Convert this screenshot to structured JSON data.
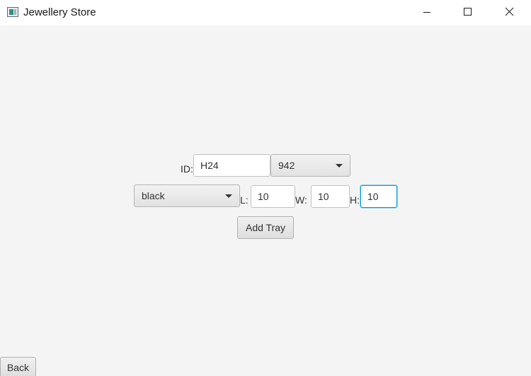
{
  "window": {
    "title": "Jewellery Store",
    "controls": {
      "minimize_icon": "minimize-icon",
      "maximize_icon": "maximize-icon",
      "close_icon": "close-icon"
    }
  },
  "form": {
    "id_label": "ID:",
    "id_value": "H24",
    "number_select": "942",
    "color_select": "black",
    "length_label": "L:",
    "length_value": "10",
    "width_label": "W:",
    "width_value": "10",
    "height_label": "H:",
    "height_value": "10",
    "add_button": "Add Tray"
  },
  "footer": {
    "back_button": "Back"
  },
  "colors": {
    "background": "#f4f4f4",
    "focus_accent": "#039ed3"
  }
}
